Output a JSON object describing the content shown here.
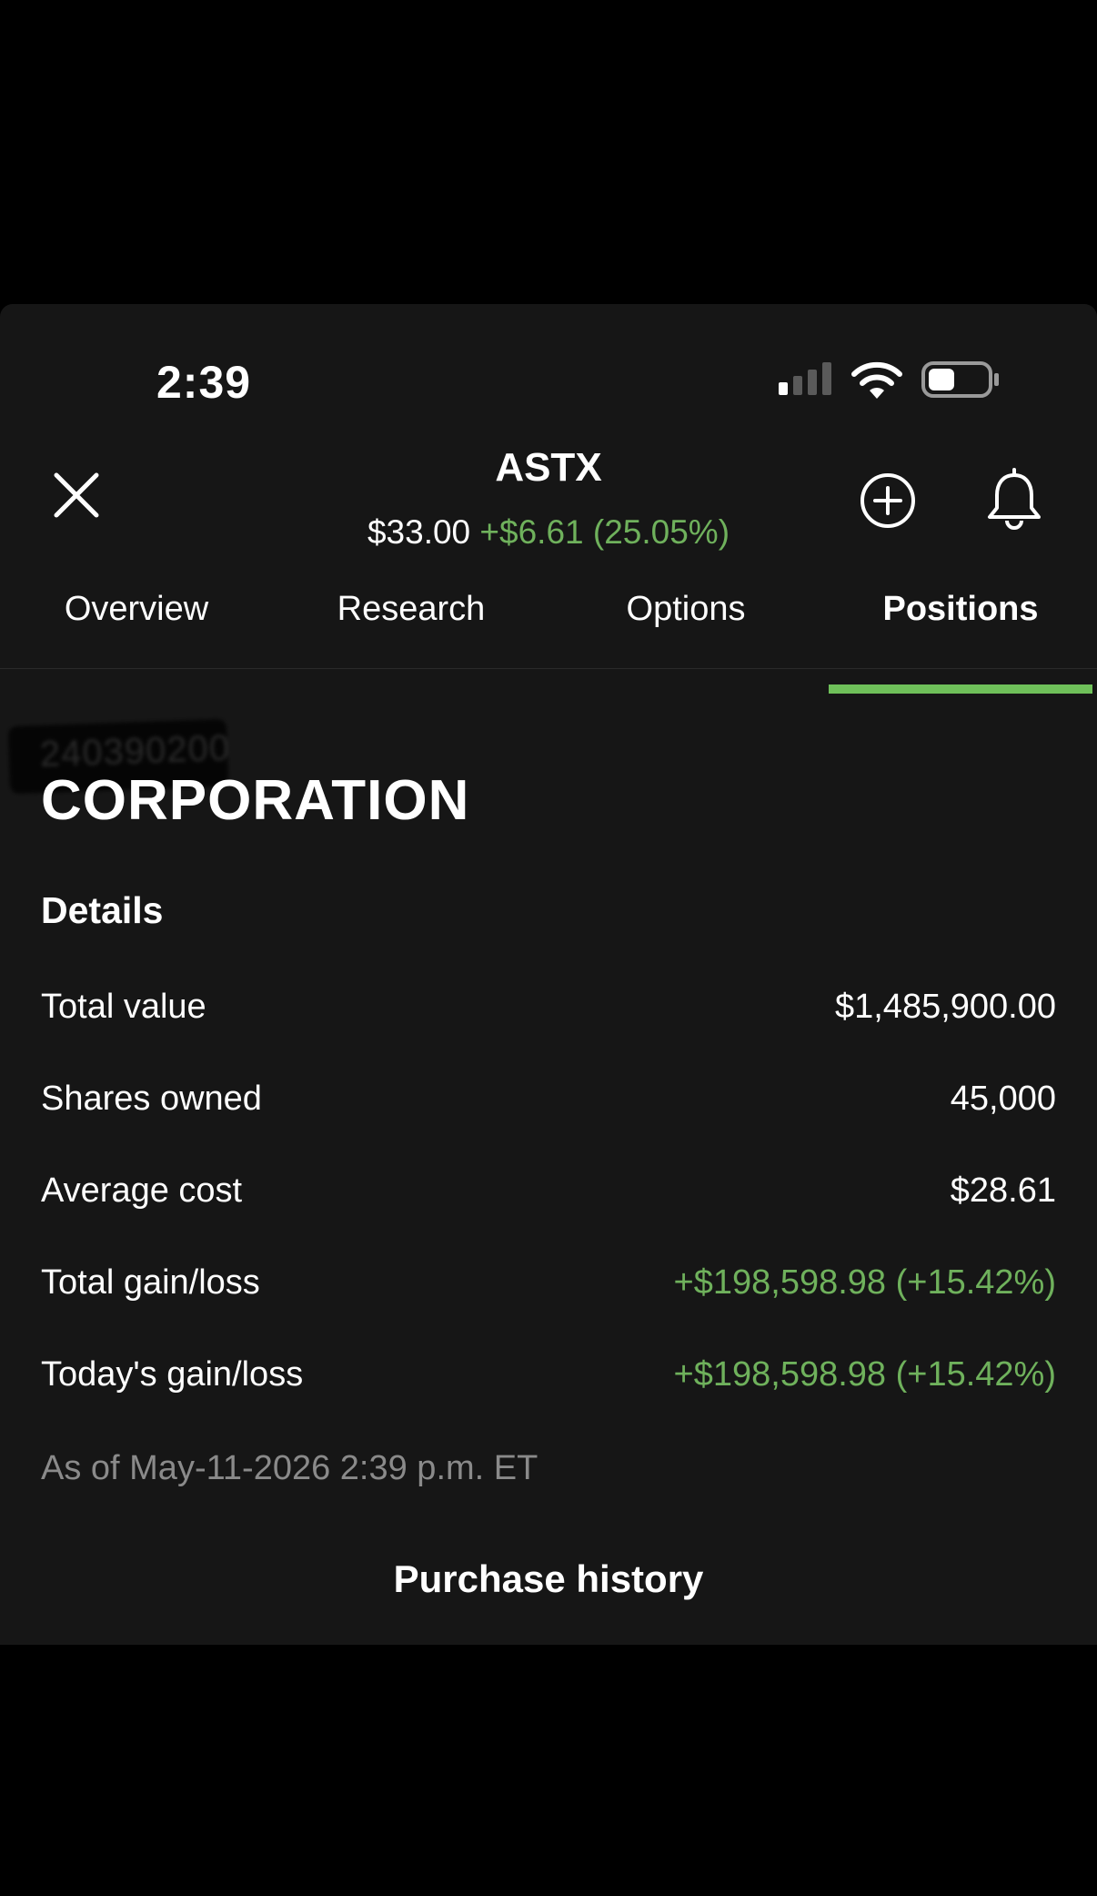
{
  "status_bar": {
    "time": "2:39"
  },
  "header": {
    "ticker": "ASTX",
    "price": "$33.00",
    "change": "+$6.61 (25.05%)"
  },
  "tabs": [
    {
      "label": "Overview"
    },
    {
      "label": "Research"
    },
    {
      "label": "Options"
    },
    {
      "label": "Positions",
      "active": true
    }
  ],
  "position": {
    "account_redacted": "240390200",
    "company": "CORPORATION",
    "details_title": "Details",
    "rows": [
      {
        "label": "Total value",
        "value": "$1,485,900.00",
        "color": "#ffffff"
      },
      {
        "label": "Shares owned",
        "value": "45,000",
        "color": "#ffffff"
      },
      {
        "label": "Average cost",
        "value": "$28.61",
        "color": "#ffffff"
      },
      {
        "label": "Total gain/loss",
        "value": "+$198,598.98 (+15.42%)",
        "color": "#6fb15c"
      },
      {
        "label": "Today's gain/loss",
        "value": "+$198,598.98 (+15.42%)",
        "color": "#6fb15c"
      }
    ],
    "as_of": "As of May-11-2026 2:39 p.m. ET",
    "purchase_history_label": "Purchase history"
  },
  "colors": {
    "background": "#000000",
    "panel": "#161616",
    "accent_green": "#6fc05a",
    "gain_text": "#6fb15c",
    "muted_text": "#8a8a8a"
  },
  "icons": [
    "signal-icon",
    "wifi-icon",
    "battery-icon",
    "close-icon",
    "add-circle-icon",
    "bell-icon"
  ]
}
